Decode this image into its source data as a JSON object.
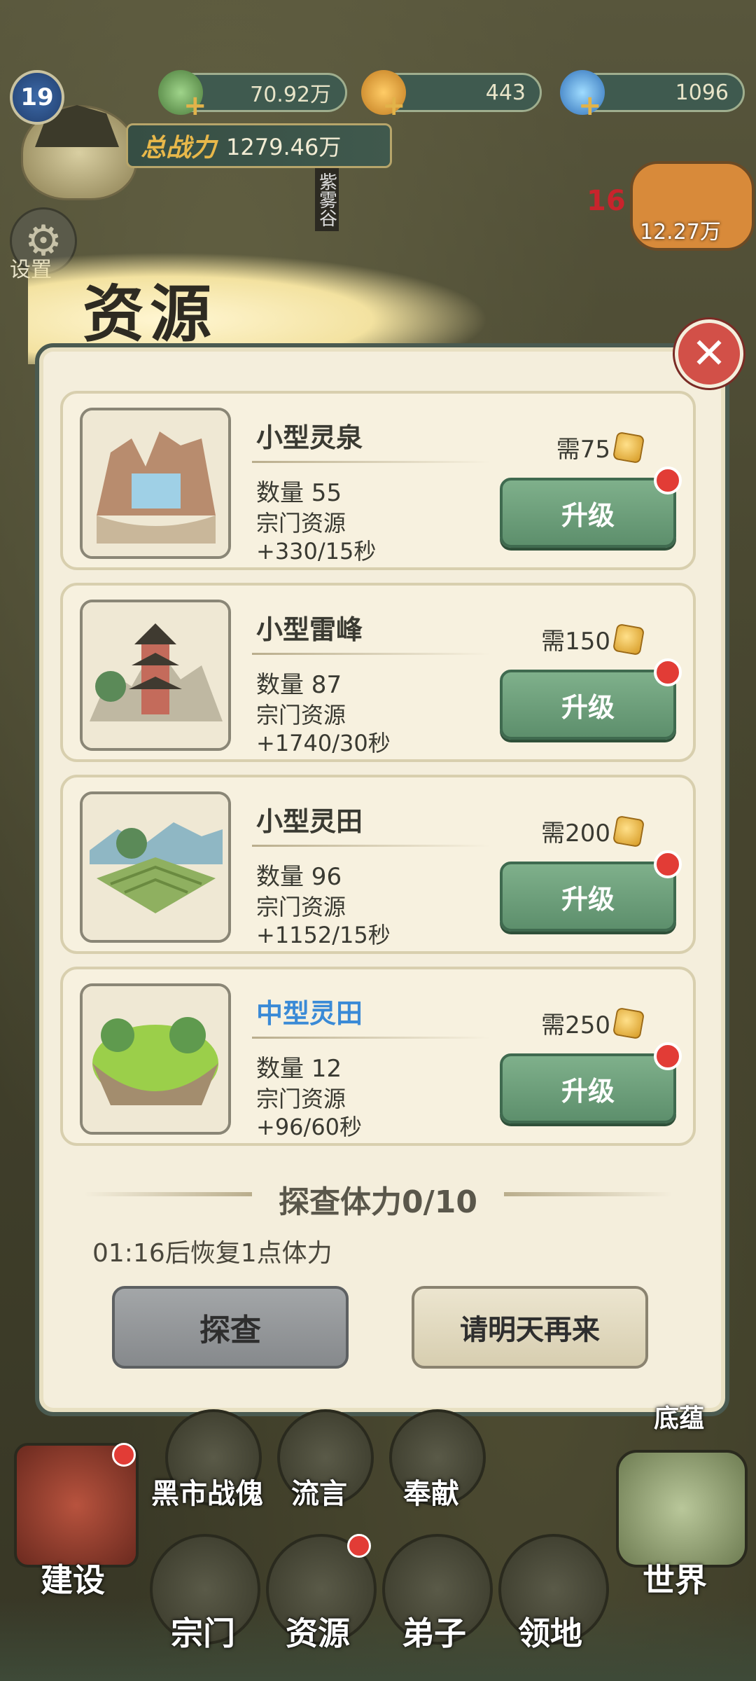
{
  "hud": {
    "level": "19",
    "resources": [
      {
        "icon": "spirit-stone-icon",
        "value": "70.92万"
      },
      {
        "icon": "gold-ingot-icon",
        "value": "443"
      },
      {
        "icon": "crystal-icon",
        "value": "1096"
      }
    ],
    "power_label": "总战力",
    "power_value": "1279.46万",
    "location_sign": "紫雾谷",
    "settings_label": "设置",
    "bag_value": "12.27万",
    "red_count": "16"
  },
  "panel": {
    "title": "资源",
    "items": [
      {
        "name": "小型灵泉",
        "count": "数量 55",
        "type": "宗门资源",
        "rate": "+330/15秒",
        "cost": "需75",
        "button": "升级"
      },
      {
        "name": "小型雷峰",
        "count": "数量 87",
        "type": "宗门资源",
        "rate": "+1740/30秒",
        "cost": "需150",
        "button": "升级"
      },
      {
        "name": "小型灵田",
        "count": "数量 96",
        "type": "宗门资源",
        "rate": "+1152/15秒",
        "cost": "需200",
        "button": "升级"
      },
      {
        "name": "中型灵田",
        "count": "数量 12",
        "type": "宗门资源",
        "rate": "+96/60秒",
        "cost": "需250",
        "button": "升级"
      }
    ],
    "explore_title": "探查体力0/10",
    "recover_text": "01:16后恢复1点体力",
    "explore_button": "探查",
    "tomorrow_button": "请明天再来"
  },
  "bottom_nav": {
    "row1": [
      "黑市战傀",
      "流言",
      "奉献"
    ],
    "row2": [
      "宗门",
      "资源",
      "弟子",
      "领地"
    ],
    "left": "建设",
    "right": "世界",
    "right_top": "底蕴"
  },
  "colors": {
    "accent_green": "#5d8f6c",
    "panel_bg": "#f4eedc",
    "highlight_blue": "#3a8ad6",
    "badge_red": "#e23c36"
  }
}
